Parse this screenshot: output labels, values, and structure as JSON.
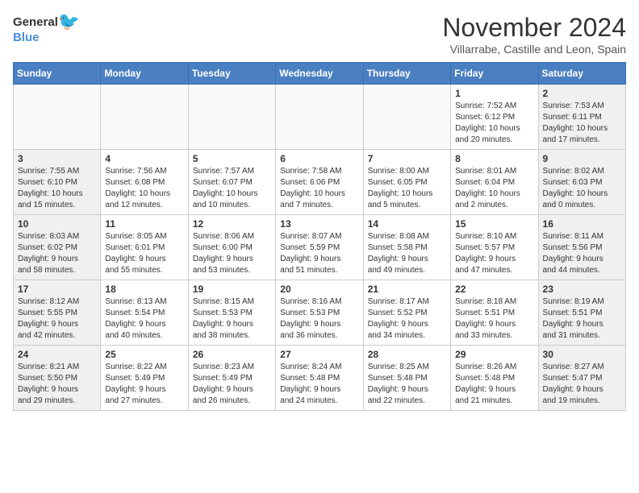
{
  "logo": {
    "general": "General",
    "blue": "Blue"
  },
  "header": {
    "month": "November 2024",
    "location": "Villarrabe, Castille and Leon, Spain"
  },
  "days_of_week": [
    "Sunday",
    "Monday",
    "Tuesday",
    "Wednesday",
    "Thursday",
    "Friday",
    "Saturday"
  ],
  "weeks": [
    [
      {
        "day": "",
        "info": "",
        "type": "empty"
      },
      {
        "day": "",
        "info": "",
        "type": "empty"
      },
      {
        "day": "",
        "info": "",
        "type": "empty"
      },
      {
        "day": "",
        "info": "",
        "type": "empty"
      },
      {
        "day": "",
        "info": "",
        "type": "empty"
      },
      {
        "day": "1",
        "info": "Sunrise: 7:52 AM\nSunset: 6:12 PM\nDaylight: 10 hours\nand 20 minutes.",
        "type": "weekday"
      },
      {
        "day": "2",
        "info": "Sunrise: 7:53 AM\nSunset: 6:11 PM\nDaylight: 10 hours\nand 17 minutes.",
        "type": "weekend"
      }
    ],
    [
      {
        "day": "3",
        "info": "Sunrise: 7:55 AM\nSunset: 6:10 PM\nDaylight: 10 hours\nand 15 minutes.",
        "type": "weekend"
      },
      {
        "day": "4",
        "info": "Sunrise: 7:56 AM\nSunset: 6:08 PM\nDaylight: 10 hours\nand 12 minutes.",
        "type": "weekday"
      },
      {
        "day": "5",
        "info": "Sunrise: 7:57 AM\nSunset: 6:07 PM\nDaylight: 10 hours\nand 10 minutes.",
        "type": "weekday"
      },
      {
        "day": "6",
        "info": "Sunrise: 7:58 AM\nSunset: 6:06 PM\nDaylight: 10 hours\nand 7 minutes.",
        "type": "weekday"
      },
      {
        "day": "7",
        "info": "Sunrise: 8:00 AM\nSunset: 6:05 PM\nDaylight: 10 hours\nand 5 minutes.",
        "type": "weekday"
      },
      {
        "day": "8",
        "info": "Sunrise: 8:01 AM\nSunset: 6:04 PM\nDaylight: 10 hours\nand 2 minutes.",
        "type": "weekday"
      },
      {
        "day": "9",
        "info": "Sunrise: 8:02 AM\nSunset: 6:03 PM\nDaylight: 10 hours\nand 0 minutes.",
        "type": "weekend"
      }
    ],
    [
      {
        "day": "10",
        "info": "Sunrise: 8:03 AM\nSunset: 6:02 PM\nDaylight: 9 hours\nand 58 minutes.",
        "type": "weekend"
      },
      {
        "day": "11",
        "info": "Sunrise: 8:05 AM\nSunset: 6:01 PM\nDaylight: 9 hours\nand 55 minutes.",
        "type": "weekday"
      },
      {
        "day": "12",
        "info": "Sunrise: 8:06 AM\nSunset: 6:00 PM\nDaylight: 9 hours\nand 53 minutes.",
        "type": "weekday"
      },
      {
        "day": "13",
        "info": "Sunrise: 8:07 AM\nSunset: 5:59 PM\nDaylight: 9 hours\nand 51 minutes.",
        "type": "weekday"
      },
      {
        "day": "14",
        "info": "Sunrise: 8:08 AM\nSunset: 5:58 PM\nDaylight: 9 hours\nand 49 minutes.",
        "type": "weekday"
      },
      {
        "day": "15",
        "info": "Sunrise: 8:10 AM\nSunset: 5:57 PM\nDaylight: 9 hours\nand 47 minutes.",
        "type": "weekday"
      },
      {
        "day": "16",
        "info": "Sunrise: 8:11 AM\nSunset: 5:56 PM\nDaylight: 9 hours\nand 44 minutes.",
        "type": "weekend"
      }
    ],
    [
      {
        "day": "17",
        "info": "Sunrise: 8:12 AM\nSunset: 5:55 PM\nDaylight: 9 hours\nand 42 minutes.",
        "type": "weekend"
      },
      {
        "day": "18",
        "info": "Sunrise: 8:13 AM\nSunset: 5:54 PM\nDaylight: 9 hours\nand 40 minutes.",
        "type": "weekday"
      },
      {
        "day": "19",
        "info": "Sunrise: 8:15 AM\nSunset: 5:53 PM\nDaylight: 9 hours\nand 38 minutes.",
        "type": "weekday"
      },
      {
        "day": "20",
        "info": "Sunrise: 8:16 AM\nSunset: 5:53 PM\nDaylight: 9 hours\nand 36 minutes.",
        "type": "weekday"
      },
      {
        "day": "21",
        "info": "Sunrise: 8:17 AM\nSunset: 5:52 PM\nDaylight: 9 hours\nand 34 minutes.",
        "type": "weekday"
      },
      {
        "day": "22",
        "info": "Sunrise: 8:18 AM\nSunset: 5:51 PM\nDaylight: 9 hours\nand 33 minutes.",
        "type": "weekday"
      },
      {
        "day": "23",
        "info": "Sunrise: 8:19 AM\nSunset: 5:51 PM\nDaylight: 9 hours\nand 31 minutes.",
        "type": "weekend"
      }
    ],
    [
      {
        "day": "24",
        "info": "Sunrise: 8:21 AM\nSunset: 5:50 PM\nDaylight: 9 hours\nand 29 minutes.",
        "type": "weekend"
      },
      {
        "day": "25",
        "info": "Sunrise: 8:22 AM\nSunset: 5:49 PM\nDaylight: 9 hours\nand 27 minutes.",
        "type": "weekday"
      },
      {
        "day": "26",
        "info": "Sunrise: 8:23 AM\nSunset: 5:49 PM\nDaylight: 9 hours\nand 26 minutes.",
        "type": "weekday"
      },
      {
        "day": "27",
        "info": "Sunrise: 8:24 AM\nSunset: 5:48 PM\nDaylight: 9 hours\nand 24 minutes.",
        "type": "weekday"
      },
      {
        "day": "28",
        "info": "Sunrise: 8:25 AM\nSunset: 5:48 PM\nDaylight: 9 hours\nand 22 minutes.",
        "type": "weekday"
      },
      {
        "day": "29",
        "info": "Sunrise: 8:26 AM\nSunset: 5:48 PM\nDaylight: 9 hours\nand 21 minutes.",
        "type": "weekday"
      },
      {
        "day": "30",
        "info": "Sunrise: 8:27 AM\nSunset: 5:47 PM\nDaylight: 9 hours\nand 19 minutes.",
        "type": "weekend"
      }
    ]
  ]
}
